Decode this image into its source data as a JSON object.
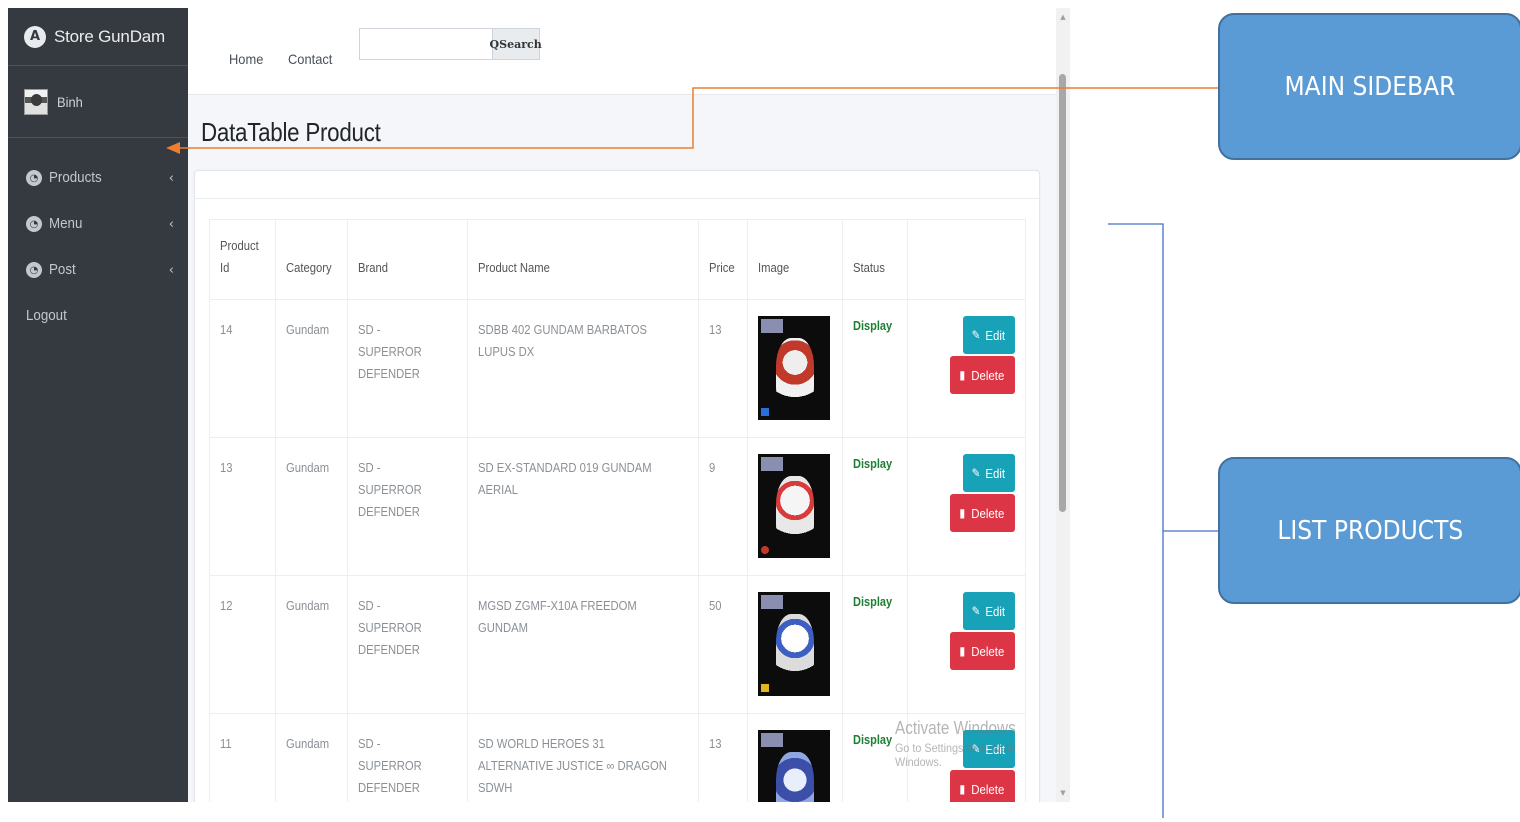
{
  "brand": {
    "name": "Store GunDam",
    "logo_letter": "A"
  },
  "user": {
    "name": "Binh"
  },
  "sidebar": {
    "items": [
      {
        "label": "Products",
        "chevron": "‹",
        "icon": "dashboard-icon"
      },
      {
        "label": "Menu",
        "chevron": "‹",
        "icon": "dashboard-icon"
      },
      {
        "label": "Post",
        "chevron": "‹",
        "icon": "dashboard-icon"
      },
      {
        "label": "Logout"
      }
    ]
  },
  "topbar": {
    "links": [
      "Home",
      "Contact"
    ],
    "search": {
      "value": "",
      "placeholder": "",
      "button_label": "Search",
      "button_icon": "Q"
    }
  },
  "page": {
    "title": "DataTable Product"
  },
  "table": {
    "headers": [
      "Product Id",
      "Category",
      "Brand",
      "Product Name",
      "Price",
      "Image",
      "Status",
      ""
    ],
    "rows": [
      {
        "id": "14",
        "category": "Gundam",
        "brand": "SD - SUPERROR DEFENDER",
        "name": "SDBB 402 GUNDAM BARBATOS LUPUS DX",
        "price": "13",
        "status": "Display",
        "edit": "Edit",
        "delete": "Delete"
      },
      {
        "id": "13",
        "category": "Gundam",
        "brand": "SD - SUPERROR DEFENDER",
        "name": "SD EX-STANDARD 019 GUNDAM AERIAL",
        "price": "9",
        "status": "Display",
        "edit": "Edit",
        "delete": "Delete"
      },
      {
        "id": "12",
        "category": "Gundam",
        "brand": "SD - SUPERROR DEFENDER",
        "name": "MGSD ZGMF-X10A FREEDOM GUNDAM",
        "price": "50",
        "status": "Display",
        "edit": "Edit",
        "delete": "Delete"
      },
      {
        "id": "11",
        "category": "Gundam",
        "brand": "SD - SUPERROR DEFENDER",
        "name": "SD WORLD HEROES 31 ALTERNATIVE JUSTICE ∞ DRAGON SDWH",
        "price": "13",
        "status": "Display",
        "edit": "Edit",
        "delete": "Delete"
      }
    ]
  },
  "watermark": {
    "line1": "Activate Windows",
    "line2": "Go to Settings to activate Windows."
  },
  "annotations": {
    "main_sidebar": "MAIN SIDEBAR",
    "list_products": "LIST PRODUCTS"
  },
  "colors": {
    "sidebar_bg": "#343a40",
    "edit_button": "#17a2b8",
    "delete_button": "#dc3545",
    "status_text": "#1e7e34",
    "callout_fill": "#5b9bd5",
    "arrow_orange": "#ed7d31",
    "bracket_blue": "#4472c4"
  }
}
